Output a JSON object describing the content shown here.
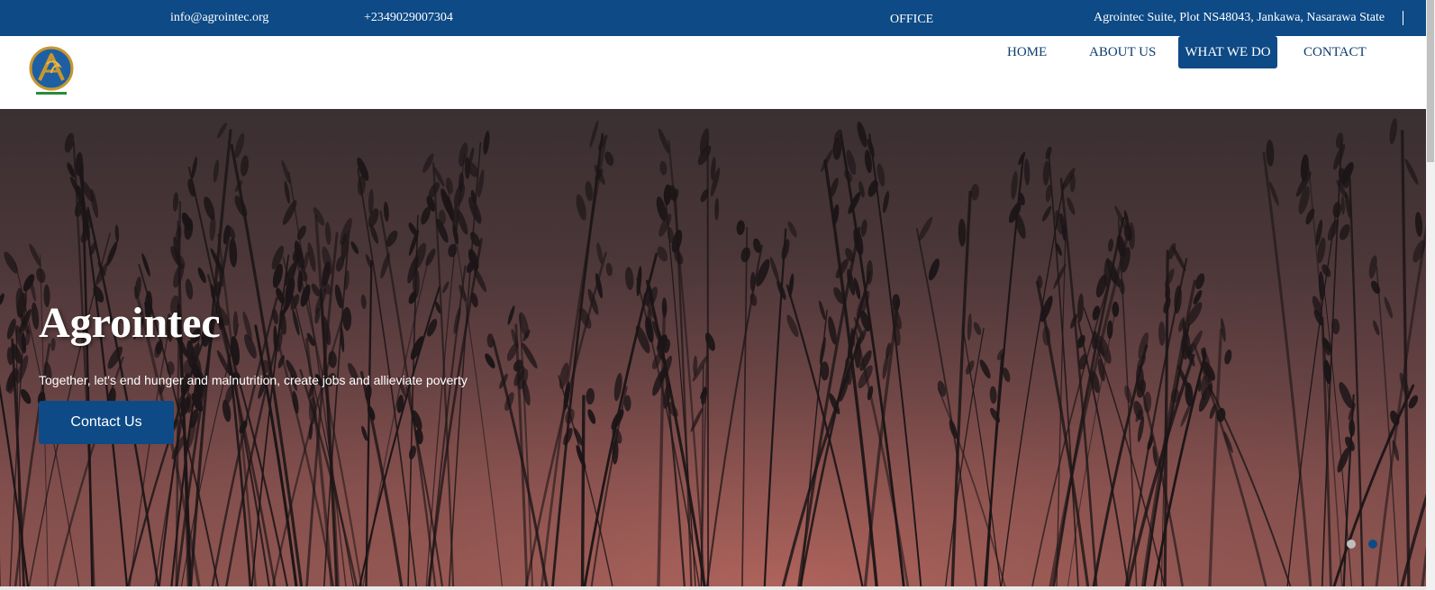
{
  "topbar": {
    "email": "info@agrointec.org",
    "phone": "+2349029007304",
    "office_label": "OFFICE",
    "address": "Agrointec Suite, Plot NS48043, Jankawa, Nasarawa State"
  },
  "header": {
    "logo_icon": "agrointec-logo-icon",
    "nav": {
      "home": "HOME",
      "about": "ABOUT US",
      "what_we_do": "WHAT WE DO",
      "contact": "CONTACT"
    },
    "active_nav": "what_we_do"
  },
  "hero": {
    "title": "Agrointec",
    "subtitle": "Together, let's end hunger and malnutrition, create jobs and allieviate poverty",
    "cta_label": "Contact Us",
    "slides_total": 2,
    "active_slide": 2
  },
  "colors": {
    "brand_blue": "#0d4a86",
    "nav_text": "#0d3c6e",
    "white": "#ffffff",
    "dot_inactive": "#bdbdbd"
  }
}
